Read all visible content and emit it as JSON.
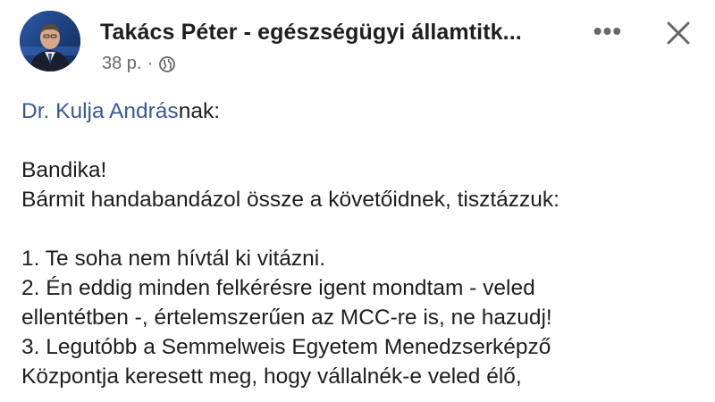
{
  "post": {
    "author": "Takács Péter - egészségügyi államtitk...",
    "time": "38 p.",
    "separator": "·",
    "privacy_icon": "globe-icon",
    "more_icon": "more-options-icon",
    "more_label": "•••",
    "close_icon": "close-icon",
    "mention": "Dr. Kulja András",
    "mention_suffix": "nak:",
    "lines": [
      "Bandika!",
      "Bármit handabandázol össze a követőidnek, tisztázzuk:",
      "1. Te soha nem hívtál ki vitázni.",
      "2. Én eddig minden felkérésre igent mondtam - veled",
      "ellentétben -, értelemszerűen az MCC-re is, ne hazudj!",
      "3. Legutóbb a Semmelweis Egyetem Menedzserképző",
      "Központja keresett meg, hogy vállalnék-e veled élő,"
    ]
  },
  "colors": {
    "link": "#385898",
    "secondary": "#65676b",
    "text": "#1c1e21"
  }
}
